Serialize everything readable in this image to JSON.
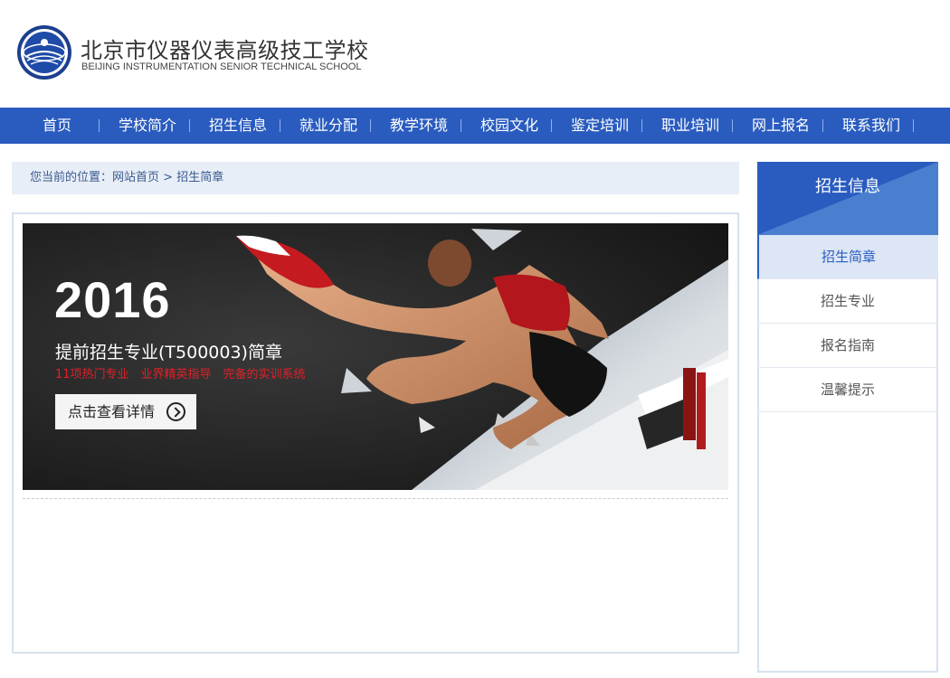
{
  "header": {
    "school_name_cn": "北京市仪器仪表高级技工学校",
    "school_name_en": "BEIJING INSTRUMENTATION SENIOR TECHNICAL SCHOOL"
  },
  "nav": {
    "items": [
      "首页",
      "学校简介",
      "招生信息",
      "就业分配",
      "教学环境",
      "校园文化",
      "鉴定培训",
      "职业培训",
      "网上报名",
      "联系我们"
    ]
  },
  "breadcrumb": {
    "prefix": "您当前的位置：",
    "home": "网站首页",
    "sep": " > ",
    "current": "招生简章"
  },
  "banner": {
    "year": "2016",
    "title": "提前招生专业(T500003)简章",
    "subtitle": "11项热门专业　业界精英指导　完备的实训系统",
    "button_label": "点击查看详情"
  },
  "sidebar": {
    "title": "招生信息",
    "items": [
      "招生简章",
      "招生专业",
      "报名指南",
      "温馨提示"
    ],
    "active_index": 0
  },
  "colors": {
    "nav_bg": "#2a5cbf",
    "sidebar_head": "#2a5cbf",
    "breadcrumb_bg": "#e8eef7",
    "banner_accent": "#e0202a"
  },
  "icons": {
    "logo": "school-emblem-icon",
    "button_arrow": "circle-arrow-right-icon"
  }
}
